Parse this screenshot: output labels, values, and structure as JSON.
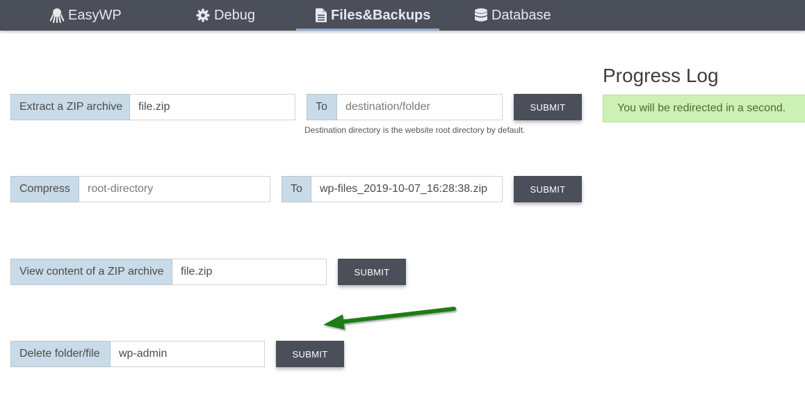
{
  "nav": {
    "items": [
      {
        "label": "EasyWP",
        "icon": "octopus-icon"
      },
      {
        "label": "Debug",
        "icon": "gear-icon"
      },
      {
        "label": "Files&Backups",
        "icon": "file-icon",
        "active": true
      },
      {
        "label": "Database",
        "icon": "database-icon"
      }
    ]
  },
  "extract": {
    "label": "Extract a ZIP archive",
    "file_value": "file.zip",
    "to_label": "To",
    "dest_placeholder": "destination/folder",
    "submit": "SUBMIT",
    "hint": "Destination directory is the website root directory by default."
  },
  "compress": {
    "label": "Compress",
    "source_placeholder": "root-directory",
    "to_label": "To",
    "dest_value": "wp-files_2019-10-07_16:28:38.zip",
    "submit": "SUBMIT"
  },
  "view": {
    "label": "View content of a ZIP archive",
    "file_value": "file.zip",
    "submit": "SUBMIT"
  },
  "delete": {
    "label": "Delete folder/file",
    "path_value": "wp-admin",
    "submit": "SUBMIT"
  },
  "progress": {
    "title": "Progress Log",
    "message": "You will be redirected in a second."
  },
  "colors": {
    "navbar": "#4a4f5a",
    "addon": "#c9dbe8",
    "button": "#4a4f5a",
    "success_bg": "#cdf0b4",
    "arrow": "#1e7d12"
  }
}
